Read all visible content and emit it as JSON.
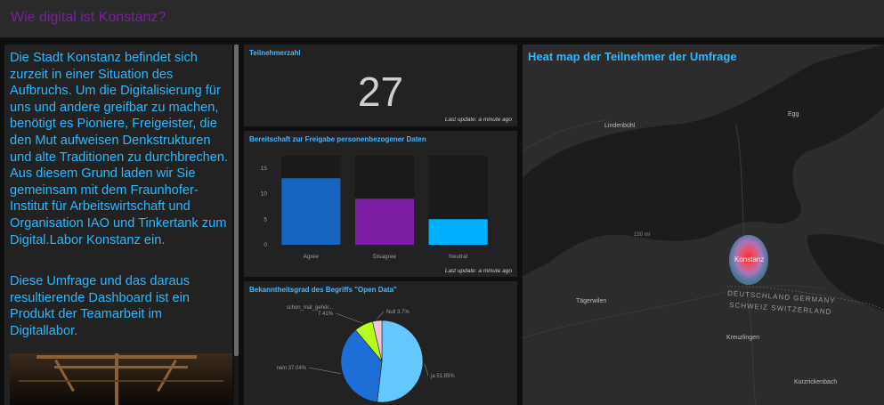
{
  "header": {
    "title": "Wie digital ist Konstanz?"
  },
  "intro": {
    "paragraph1": "Die Stadt Konstanz befindet sich zurzeit in einer Situation des Aufbruchs. Um die Digitalisierung für uns und andere greifbar zu machen, benötigt es Pioniere, Freigeister, die den Mut aufweisen Denkstrukturen und alte Traditionen zu durchbrechen. Aus diesem Grund laden wir Sie gemeinsam mit dem Fraunhofer-Institut für Arbeitswirtschaft und Organisation IAO und Tinkertank zum Digital.Labor Konstanz ein.",
    "paragraph2": "Diese Umfrage und das daraus resultierende Dashboard ist ein Produkt der Teamarbeit im Digitallabor."
  },
  "count_card": {
    "title": "Teilnehmerzahl",
    "value": "27",
    "last_update": "Last update: a minute ago"
  },
  "bar_card": {
    "title": "Bereitschaft zur Freigabe personenbezogener Daten",
    "last_update": "Last update: a minute ago"
  },
  "pie_card": {
    "title": "Bekanntheitsgrad des Begriffs \"Open Data\""
  },
  "map_card": {
    "title": "Heat map der Teilnehmer der Umfrage",
    "labels": {
      "lindenbuehl": "Lindenbühl",
      "egg": "Egg",
      "taegerwilen": "Tägerwilen",
      "konstanz": "Konstanz",
      "deutschland": "DEUTSCHLAND GERMANY",
      "schweiz": "SCHWEIZ SWITZERLAND",
      "kreuzlingen": "Kreuzlingen",
      "kurzrickenbach": "Kurzrickenbach",
      "scale": "150 mi"
    }
  },
  "chart_data": [
    {
      "type": "bar",
      "title": "Bereitschaft zur Freigabe personenbezogener Daten",
      "categories": [
        "Agree",
        "Disagree",
        "Neutral"
      ],
      "values": [
        13,
        9,
        5
      ],
      "colors": [
        "#1565c0",
        "#7b1fa2",
        "#00b0ff"
      ],
      "yticks": [
        0,
        5,
        10,
        15
      ],
      "ylim": [
        0,
        16
      ],
      "grid": false
    },
    {
      "type": "pie",
      "title": "Bekanntheitsgrad des Begriffs \"Open Data\"",
      "slices": [
        {
          "label": "ja 51.85%",
          "value": 51.85,
          "color": "#64c8ff"
        },
        {
          "label": "nein 37.04%",
          "value": 37.04,
          "color": "#1e6ed8"
        },
        {
          "label": "schon_mal_gehör... 7.41%",
          "value": 7.41,
          "color": "#b6ff1a"
        },
        {
          "label": "Null 3.7%",
          "value": 3.7,
          "color": "#f2c4d6"
        }
      ]
    }
  ]
}
